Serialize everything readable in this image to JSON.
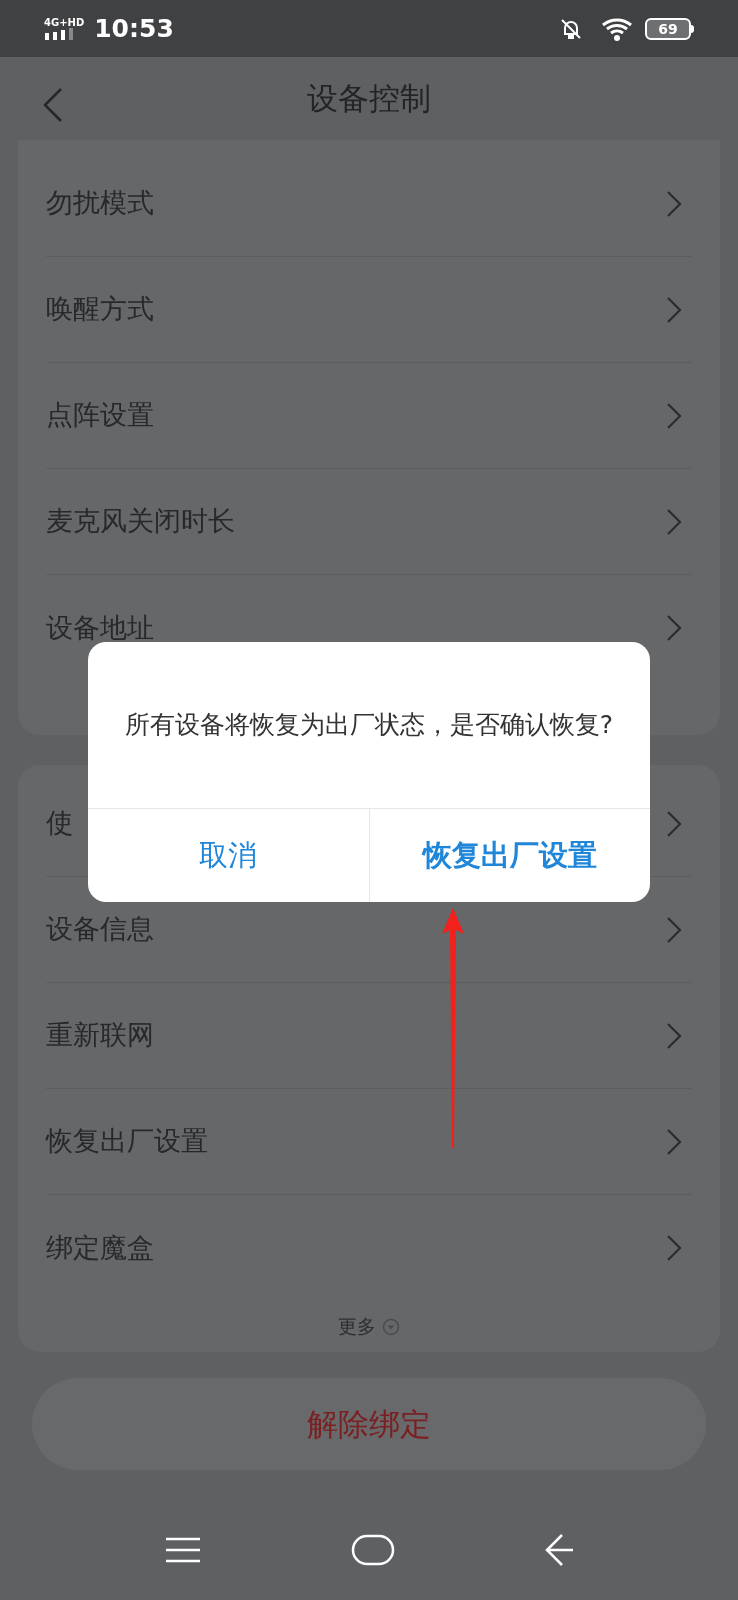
{
  "status_bar": {
    "network": "4G+HD",
    "time": "10:53",
    "battery": "69"
  },
  "header": {
    "title": "设备控制"
  },
  "sections": [
    {
      "items": [
        {
          "label": "勿扰模式"
        },
        {
          "label": "唤醒方式"
        },
        {
          "label": "点阵设置"
        },
        {
          "label": "麦克风关闭时长"
        },
        {
          "label": "设备地址"
        }
      ]
    },
    {
      "items": [
        {
          "label": "使"
        },
        {
          "label": "设备信息"
        },
        {
          "label": "重新联网"
        },
        {
          "label": "恢复出厂设置"
        },
        {
          "label": "绑定魔盒"
        }
      ],
      "more": "更多"
    }
  ],
  "unbind_button": "解除绑定",
  "dialog": {
    "message": "所有设备将恢复为出厂状态，是否确认恢复?",
    "buttons": [
      {
        "label": "取消",
        "kind": "cancel"
      },
      {
        "label": "恢复出厂设置",
        "kind": "confirm"
      }
    ]
  }
}
